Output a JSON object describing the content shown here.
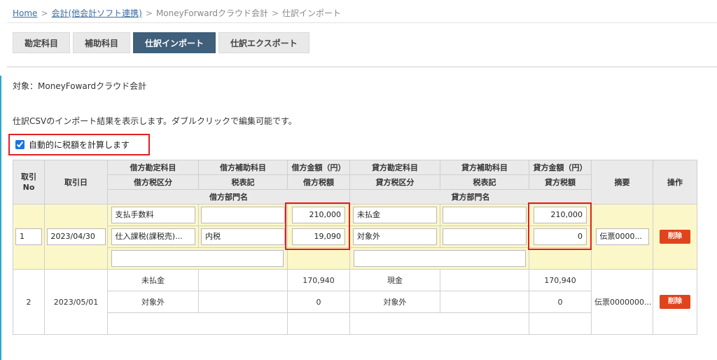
{
  "breadcrumb": {
    "home": "Home",
    "accounting": "会計(他会計ソフト連携)",
    "moneyforward": "MoneyForwardクラウド会計",
    "current": "仕訳インポート",
    "separator": ">"
  },
  "tabs": [
    {
      "label": "勘定科目",
      "active": false
    },
    {
      "label": "補助科目",
      "active": false
    },
    {
      "label": "仕訳インポート",
      "active": true
    },
    {
      "label": "仕訳エクスポート",
      "active": false
    }
  ],
  "target_text": "対象：MoneyFowardクラウド会計",
  "description": "仕訳CSVのインポート結果を表示します。ダブルクリックで編集可能です。",
  "auto_calc": {
    "label": "自動的に税額を計算します",
    "checked": true
  },
  "table": {
    "headers": {
      "no": "取引\nNo",
      "date": "取引日",
      "debit_account": "借方勘定科目",
      "debit_sub": "借方補助科目",
      "debit_amount": "借方金額（円）",
      "credit_account": "貸方勘定科目",
      "credit_sub": "貸方補助科目",
      "credit_amount": "貸方金額（円）",
      "summary": "摘要",
      "action": "操作",
      "debit_tax_cat": "借方税区分",
      "tax_note": "税表記",
      "debit_tax": "借方税額",
      "credit_tax_cat": "貸方税区分",
      "tax_note2": "税表記",
      "credit_tax": "貸方税額",
      "debit_dept": "借方部門名",
      "credit_dept": "貸方部門名"
    },
    "rows": [
      {
        "no": "1",
        "date": "2023/04/30",
        "debit_account": "支払手数料",
        "debit_sub": "",
        "debit_amount": "210,000",
        "credit_account": "未払金",
        "credit_sub": "",
        "credit_amount": "210,000",
        "debit_tax_cat": "仕入課税(課税売)...",
        "debit_tax_note": "内税",
        "debit_tax": "19,090",
        "credit_tax_cat": "対象外",
        "credit_tax_note": "",
        "credit_tax": "0",
        "summary": "伝票0000...",
        "debit_dept": "",
        "credit_dept": "",
        "delete_label": "削除"
      },
      {
        "no": "2",
        "date": "2023/05/01",
        "debit_account": "未払金",
        "debit_sub": "",
        "debit_amount": "170,940",
        "credit_account": "現金",
        "credit_sub": "",
        "credit_amount": "170,940",
        "debit_tax_cat": "対象外",
        "debit_tax_note": "",
        "debit_tax": "0",
        "credit_tax_cat": "対象外",
        "credit_tax_note": "",
        "credit_tax": "0",
        "summary": "伝票0000000...",
        "debit_dept": "",
        "credit_dept": "",
        "delete_label": "削除"
      }
    ]
  },
  "colors": {
    "accent": "#2aa7c9",
    "tab_active": "#3f5f7a",
    "highlight": "#e02020",
    "delete_button": "#e0441c",
    "editing_row": "#fbf7c8"
  }
}
